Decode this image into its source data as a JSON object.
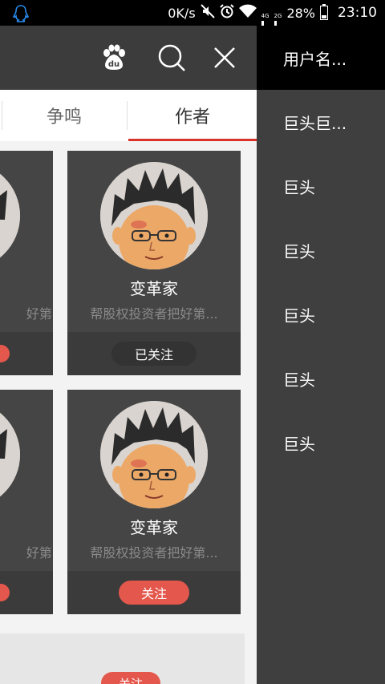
{
  "status_bar": {
    "network_speed": "0K/s",
    "network_4g": "4G",
    "network_2g": "2G",
    "battery": "28%",
    "time": "23:10"
  },
  "toolbar": {
    "baidu_label": "du"
  },
  "tabs": [
    {
      "label": "争鸣"
    },
    {
      "label": "作者",
      "active": true
    }
  ],
  "cards": [
    {
      "name": "变革家",
      "desc": "帮股权投资者把好第...",
      "follow_label": "已关注",
      "followed": true
    },
    {
      "name": "变革家",
      "desc": "帮股权投资者把好第...",
      "follow_label": "关注",
      "followed": false
    }
  ],
  "left_cards": [
    {
      "desc_fragment": "好第..."
    },
    {
      "desc_fragment": "好第..."
    }
  ],
  "bottom_partial": {
    "follow_label": "关注"
  },
  "drawer": {
    "username": "用户名...",
    "items": [
      {
        "label": "巨头巨..."
      },
      {
        "label": "巨头"
      },
      {
        "label": "巨头"
      },
      {
        "label": "巨头"
      },
      {
        "label": "巨头"
      },
      {
        "label": "巨头"
      }
    ]
  },
  "colors": {
    "accent_red": "#d9342b",
    "follow_button": "#e4574c",
    "card_bg": "#454545",
    "drawer_bg": "#3f3f3f",
    "topbar_bg": "#3c3c3c"
  }
}
